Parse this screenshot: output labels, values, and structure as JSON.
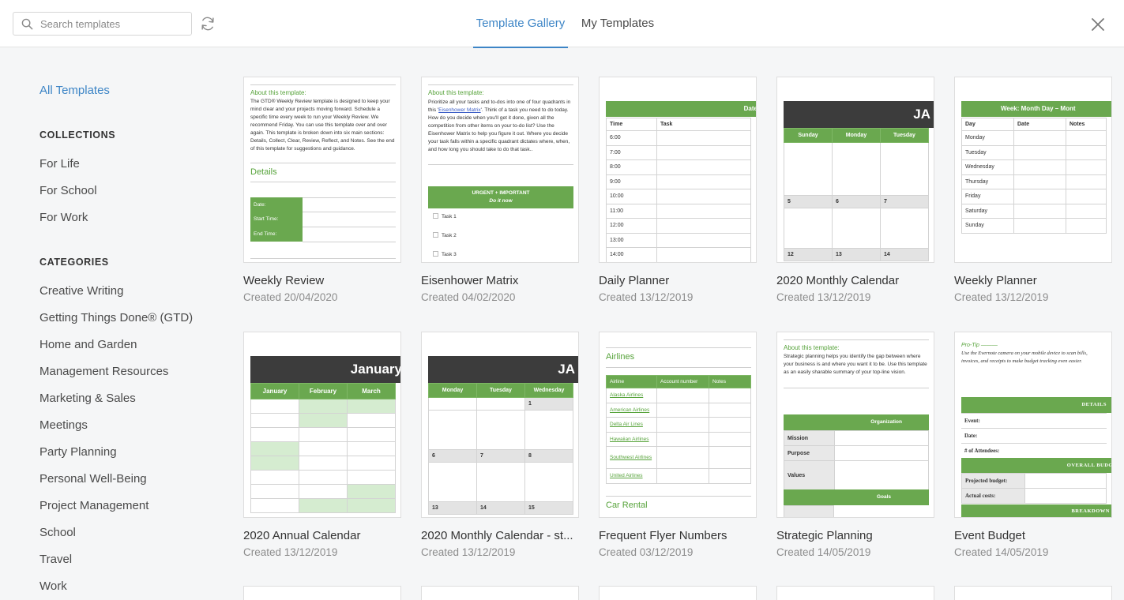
{
  "header": {
    "search_placeholder": "Search templates",
    "tabs": [
      {
        "label": "Template Gallery",
        "active": true
      },
      {
        "label": "My Templates",
        "active": false
      }
    ]
  },
  "sidebar": {
    "all_templates": "All Templates",
    "collections_heading": "COLLECTIONS",
    "collections": [
      "For Life",
      "For School",
      "For Work"
    ],
    "categories_heading": "CATEGORIES",
    "categories": [
      "Creative Writing",
      "Getting Things Done® (GTD)",
      "Home and Garden",
      "Management Resources",
      "Marketing & Sales",
      "Meetings",
      "Party Planning",
      "Personal Well-Being",
      "Project Management",
      "School",
      "Travel",
      "Work"
    ]
  },
  "templates": [
    {
      "title": "Weekly Review",
      "date": "Created 20/04/2020"
    },
    {
      "title": "Eisenhower Matrix",
      "date": "Created 04/02/2020"
    },
    {
      "title": "Daily Planner",
      "date": "Created 13/12/2019"
    },
    {
      "title": "2020 Monthly Calendar",
      "date": "Created 13/12/2019"
    },
    {
      "title": "Weekly Planner",
      "date": "Created 13/12/2019"
    },
    {
      "title": "2020 Annual Calendar",
      "date": "Created 13/12/2019"
    },
    {
      "title": "2020 Monthly Calendar - st...",
      "date": "Created 13/12/2019"
    },
    {
      "title": "Frequent Flyer Numbers",
      "date": "Created 03/12/2019"
    },
    {
      "title": "Strategic Planning",
      "date": "Created 14/05/2019"
    },
    {
      "title": "Event Budget",
      "date": "Created 14/05/2019"
    }
  ],
  "thumbs": {
    "weekly_review": {
      "about": "About this template:",
      "body": "The GTD® Weekly Review template is designed to keep your mind clear and your projects moving forward. Schedule a specific time every week to run your Weekly Review. We recommend Friday. You can use this template over and over again. This template is broken down into six main sections: Details, Collect, Clear, Review, Reflect, and Notes. See the end of this template for suggestions and guidance.",
      "details": "Details",
      "fields": [
        "Date:",
        "Start Time:",
        "End Time:"
      ]
    },
    "eisenhower": {
      "about": "About this template:",
      "body_a": "Prioritize all your tasks and to-dos into one of four quadrants in this '",
      "link": "Eisenhower Matrix",
      "body_b": "'. Think of a task you need to do today. How do you decide when you'll get it done, given all the competition from other items on your to-do list? Use the Eisenhower Matrix to help you figure it out. Where you decide your task falls within a specific quadrant dictates where, when, and how long you should take to do that task..",
      "bar_title": "URGENT + IMPORTANT",
      "bar_sub": "Do it now",
      "tasks": [
        "Task 1",
        "Task 2",
        "Task 3"
      ]
    },
    "daily_planner": {
      "header": "Date",
      "col_time": "Time",
      "col_task": "Task",
      "times": [
        "6:00",
        "7:00",
        "8:00",
        "9:00",
        "10:00",
        "11:00",
        "12:00",
        "13:00",
        "14:00"
      ]
    },
    "monthly_calendar": {
      "month": "JA",
      "days": [
        "Sunday",
        "Monday",
        "Tuesday"
      ],
      "week_rows": [
        [
          "5",
          "6",
          "7"
        ],
        [
          "12",
          "13",
          "14"
        ]
      ]
    },
    "weekly_planner": {
      "header": "Week: Month Day – Mont",
      "cols": [
        "Day",
        "Date",
        "Notes"
      ],
      "days": [
        "Monday",
        "Tuesday",
        "Wednesday",
        "Thursday",
        "Friday",
        "Saturday",
        "Sunday"
      ]
    },
    "annual_calendar": {
      "month": "January",
      "months": [
        "January",
        "February",
        "March"
      ]
    },
    "monthly_calendar_st": {
      "month": "JA",
      "days": [
        "Monday",
        "Tuesday",
        "Wednesday"
      ],
      "rows": [
        [
          "",
          "",
          "1"
        ],
        [
          "6",
          "7",
          "8"
        ],
        [
          "13",
          "14",
          "15"
        ]
      ]
    },
    "frequent_flyer": {
      "section": "Airlines",
      "cols": [
        "Airline",
        "Account number",
        "Notes"
      ],
      "airlines": [
        "Alaska Airlines",
        "American Airlines",
        "Delta Air Lines",
        "Hawaiian Airlines",
        "Southwest Airlines",
        "United Airlines"
      ],
      "section2": "Car Rental"
    },
    "strategic": {
      "about": "About this template:",
      "body": "Strategic planning helps you identify the gap between where your business is and where you want it to be. Use this template as an easily sharable summary of your top-line vision.",
      "org": "Organization",
      "rows": [
        "Mission",
        "Purpose",
        "Values"
      ],
      "goals": "Goals"
    },
    "event_budget": {
      "protip": "Pro-Tip",
      "body": "Use the Evernote camera on your mobile device to scan bills, invoices, and receipts to make budget tracking even easier.",
      "details": "DETAILS",
      "fields": [
        "Event:",
        "Date:",
        "# of Attendees:"
      ],
      "overall": "OVERALL BUDG",
      "budget_rows": [
        "Projected budget:",
        "Actual costs:"
      ],
      "breakdown": "BREAKDOWN"
    }
  },
  "colors": {
    "accent": "#3d85c6",
    "green": "#6aa84f",
    "dark": "#3c3c3c",
    "muted": "#8c8c8c"
  }
}
